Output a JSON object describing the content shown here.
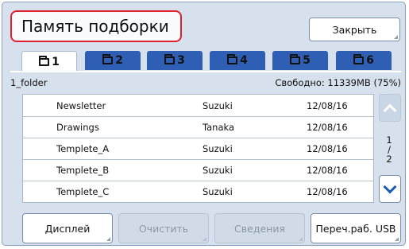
{
  "header": {
    "title": "Память подборки",
    "close_label": "Закрыть"
  },
  "tabs": [
    {
      "label": "1",
      "active": true
    },
    {
      "label": "2",
      "active": false
    },
    {
      "label": "3",
      "active": false
    },
    {
      "label": "4",
      "active": false
    },
    {
      "label": "5",
      "active": false
    },
    {
      "label": "6",
      "active": false
    }
  ],
  "info": {
    "folder_name": "1_folder",
    "free_space": "Свободно: 11339MB (75%)"
  },
  "list": {
    "rows": [
      {
        "name": "Newsletter",
        "user": "Suzuki",
        "date": "12/08/16"
      },
      {
        "name": "Drawings",
        "user": "Tanaka",
        "date": "12/08/16"
      },
      {
        "name": "Templete_A",
        "user": "Suzuki",
        "date": "12/08/16"
      },
      {
        "name": "Templete_B",
        "user": "Suzuki",
        "date": "12/08/16"
      },
      {
        "name": "Templete_C",
        "user": "Suzuki",
        "date": "12/08/16"
      }
    ]
  },
  "pager": {
    "current": "1",
    "separator": "/",
    "total": "2"
  },
  "footer": {
    "display_label": "Дисплей",
    "clear_label": "Очистить",
    "details_label": "Сведения",
    "usb_label": "Переч.раб. USB"
  },
  "colors": {
    "accent": "#2f5fb4",
    "title_border": "#e01f2d",
    "panel_bg": "#d7e1ed"
  },
  "icons": {
    "tab": "folder-icon",
    "scroll_up": "chevron-up-icon",
    "scroll_down": "chevron-down-icon"
  }
}
